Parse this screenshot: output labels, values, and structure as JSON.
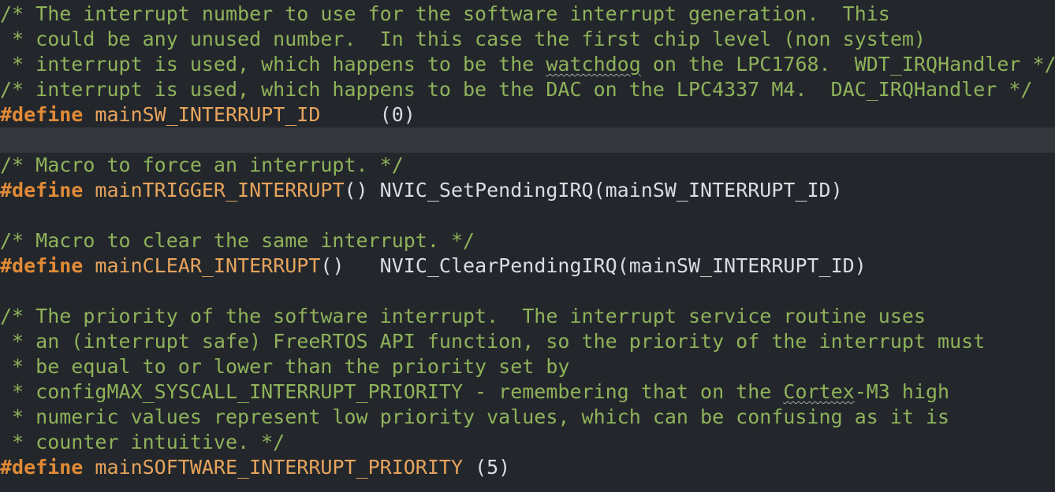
{
  "editor": {
    "lines": [
      {
        "segments": [
          {
            "text": "/* The interrupt number to use for the software interrupt generation.  This",
            "cls": "comment"
          }
        ]
      },
      {
        "segments": [
          {
            "text": " * could be any unused number.  In this case the first chip level (non system)",
            "cls": "comment"
          }
        ]
      },
      {
        "segments": [
          {
            "text": " * interrupt is used, which happens to be the ",
            "cls": "comment"
          },
          {
            "text": "watchdog",
            "cls": "comment spell"
          },
          {
            "text": " on the LPC1768.  WDT_IRQHandler */",
            "cls": "comment"
          }
        ]
      },
      {
        "segments": [
          {
            "text": "/* interrupt is used, which happens to be the DAC on the LPC4337 M4.  DAC_IRQHandler */",
            "cls": "comment"
          }
        ]
      },
      {
        "segments": [
          {
            "text": "#define",
            "cls": "kw"
          },
          {
            "text": " ",
            "cls": "plain"
          },
          {
            "text": "mainSW_INTERRUPT_ID",
            "cls": "macro"
          },
          {
            "text": "     (0)",
            "cls": "plain"
          }
        ]
      },
      {
        "segments": [
          {
            "text": "",
            "cls": "plain"
          }
        ],
        "current": true
      },
      {
        "segments": [
          {
            "text": "/* Macro to force an interrupt. */",
            "cls": "comment"
          }
        ]
      },
      {
        "segments": [
          {
            "text": "#define",
            "cls": "kw"
          },
          {
            "text": " ",
            "cls": "plain"
          },
          {
            "text": "mainTRIGGER_INTERRUPT",
            "cls": "macro"
          },
          {
            "text": "() NVIC_SetPendingIRQ(mainSW_INTERRUPT_ID)",
            "cls": "plain"
          }
        ]
      },
      {
        "segments": [
          {
            "text": "",
            "cls": "plain"
          }
        ]
      },
      {
        "segments": [
          {
            "text": "/* Macro to clear the same interrupt. */",
            "cls": "comment"
          }
        ]
      },
      {
        "segments": [
          {
            "text": "#define",
            "cls": "kw"
          },
          {
            "text": " ",
            "cls": "plain"
          },
          {
            "text": "mainCLEAR_INTERRUPT",
            "cls": "macro"
          },
          {
            "text": "()   NVIC_ClearPendingIRQ(mainSW_INTERRUPT_ID)",
            "cls": "plain"
          }
        ]
      },
      {
        "segments": [
          {
            "text": "",
            "cls": "plain"
          }
        ]
      },
      {
        "segments": [
          {
            "text": "/* The priority of the software interrupt.  The interrupt service routine uses",
            "cls": "comment"
          }
        ]
      },
      {
        "segments": [
          {
            "text": " * an (interrupt safe) FreeRTOS API function, so the priority of the interrupt must",
            "cls": "comment"
          }
        ]
      },
      {
        "segments": [
          {
            "text": " * be equal to or lower than the priority set by",
            "cls": "comment"
          }
        ]
      },
      {
        "segments": [
          {
            "text": " * configMAX_SYSCALL_INTERRUPT_PRIORITY - remembering that on the ",
            "cls": "comment"
          },
          {
            "text": "Cortex",
            "cls": "comment spell"
          },
          {
            "text": "-M3 high",
            "cls": "comment"
          }
        ]
      },
      {
        "segments": [
          {
            "text": " * numeric values represent low priority values, which can be confusing as it is",
            "cls": "comment"
          }
        ]
      },
      {
        "segments": [
          {
            "text": " * counter intuitive. */",
            "cls": "comment"
          }
        ]
      },
      {
        "segments": [
          {
            "text": "#define",
            "cls": "kw"
          },
          {
            "text": " ",
            "cls": "plain"
          },
          {
            "text": "mainSOFTWARE_INTERRUPT_PRIORITY",
            "cls": "macro"
          },
          {
            "text": " (5)",
            "cls": "plain"
          }
        ]
      }
    ]
  }
}
